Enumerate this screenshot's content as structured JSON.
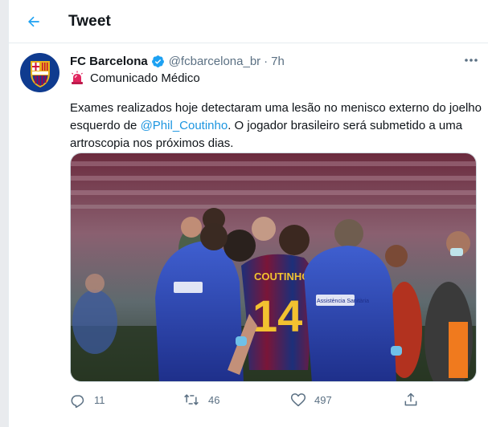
{
  "header": {
    "title": "Tweet"
  },
  "tweet": {
    "display_name": "FC Barcelona",
    "handle": "@fcbarcelona_br",
    "separator": "·",
    "time": "7h",
    "subtitle": "Comunicado Médico",
    "text_before": "Exames realizados hoje detectaram uma lesão no menisco externo do joelho esquerdo de ",
    "mention": "@Phil_Coutinho",
    "text_after": ".  O jogador brasileiro será submetido a uma artroscopia nos próximos dias.",
    "media": {
      "jersey_name": "COUTINHO",
      "jersey_number": "14",
      "jacket_text": "Assistència Sanitària"
    }
  },
  "actions": {
    "replies": "11",
    "retweets": "46",
    "likes": "497"
  },
  "colors": {
    "accent": "#1da1f2",
    "secondary_text": "#5b7083",
    "mention": "#1b95e0"
  },
  "icons": [
    "back-arrow-icon",
    "verified-badge-icon",
    "more-icon",
    "siren-icon",
    "reply-icon",
    "retweet-icon",
    "like-icon",
    "share-icon"
  ]
}
